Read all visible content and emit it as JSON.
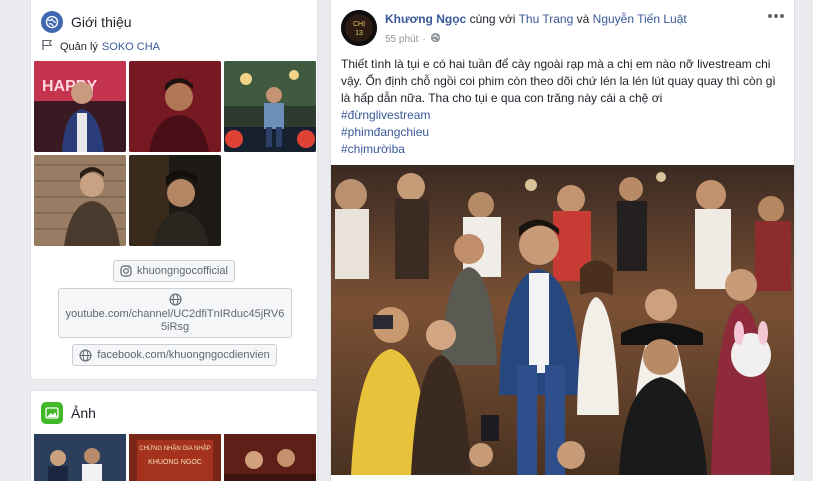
{
  "intro": {
    "title": "Giới thiệu",
    "managed_label": "Quản lý",
    "managed_page": "SOKO CHA",
    "links": {
      "instagram": "khuongngocofficial",
      "youtube": "youtube.com/channel/UC2dfiTnIRduc45jRV65iRsg",
      "facebook": "facebook.com/khuongngocdienvien"
    }
  },
  "photos": {
    "title": "Ảnh"
  },
  "post": {
    "author": "Khương Ngọc",
    "with_text": "cùng với",
    "tag1": "Thu Trang",
    "and_text": "và",
    "tag2": "Nguyễn Tiến Luật",
    "time": "55 phút",
    "body": "Thiết tình là tụi e có hai tuần để cày ngoài rạp mà a chị em nào nỡ livestream chi vậy. Ổn định chỗ ngồi coi phim còn theo dõi chứ lén la lén lút quay quay thì còn gì là hấp dẫn nữa. Tha cho tụi e qua con trăng này cái a chệ ơi",
    "hashtags": [
      "#đừnglivestream",
      "#phimđangchieu",
      "#chịmườiba"
    ]
  },
  "colors": {
    "link": "#385898",
    "page_bg": "#e9ebee",
    "meta_gray": "#90949c"
  }
}
